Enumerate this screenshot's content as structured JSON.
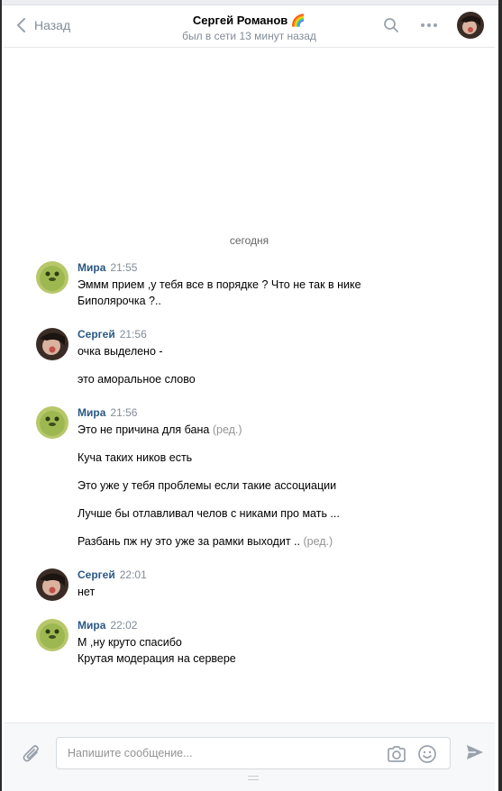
{
  "header": {
    "back_label": "Назад",
    "title": "Сергей Романов 🌈",
    "subtitle": "был в сети 13 минут назад"
  },
  "date_separator": "сегодня",
  "messages": [
    {
      "author": "Мира",
      "time": "21:55",
      "lines": [
        {
          "text": "Эммм прием ,у тебя все в порядке ? Что не так в нике",
          "edited": ""
        },
        {
          "text": "Биполярочка ?..",
          "edited": ""
        }
      ]
    },
    {
      "author": "Сергей",
      "time": "21:56",
      "lines": [
        {
          "text": "очка выделено -",
          "edited": ""
        },
        {
          "text": "это аморальное слово",
          "edited": ""
        }
      ]
    },
    {
      "author": "Мира",
      "time": "21:56",
      "lines": [
        {
          "text": "Это не причина для бана",
          "edited": "(ред.)"
        },
        {
          "text": "Куча таких ников есть",
          "edited": ""
        },
        {
          "text": "Это уже у тебя проблемы если такие ассоциации",
          "edited": ""
        },
        {
          "text": "Лучше бы отлавливал челов с никами про мать ...",
          "edited": ""
        },
        {
          "text": "Разбань пж ну это уже за рамки выходит ..",
          "edited": "(ред.)"
        }
      ]
    },
    {
      "author": "Сергей",
      "time": "22:01",
      "lines": [
        {
          "text": "нет",
          "edited": ""
        }
      ]
    },
    {
      "author": "Мира",
      "time": "22:02",
      "lines": [
        {
          "text": "М ,ну круто спасибо",
          "edited": ""
        },
        {
          "text": "Крутая модерация на сервере",
          "edited": ""
        }
      ]
    }
  ],
  "composer": {
    "placeholder": "Напишите сообщение..."
  },
  "colors": {
    "link": "#2a5885",
    "muted": "#818c99",
    "icon": "#99a2ad"
  }
}
